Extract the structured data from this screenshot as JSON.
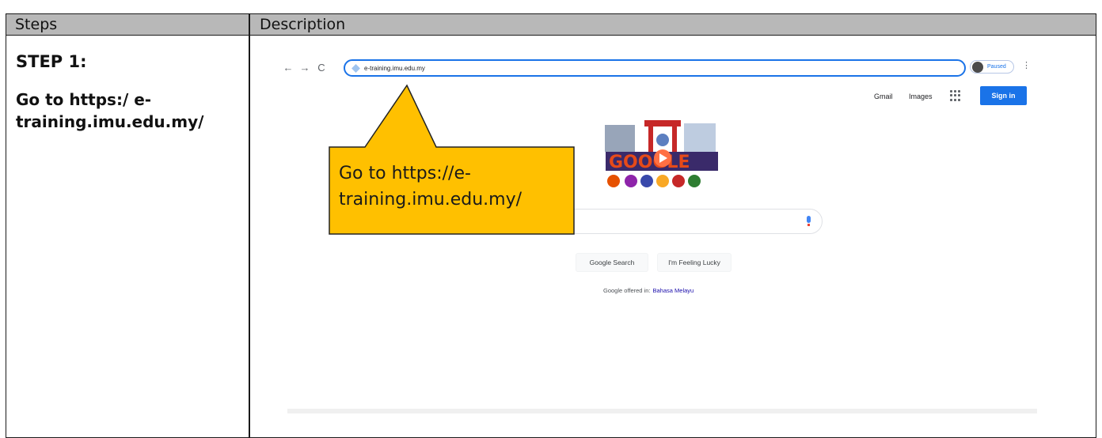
{
  "table": {
    "headers": [
      "Steps",
      "Description"
    ]
  },
  "step": {
    "title": "STEP 1:",
    "text": "Go to https:/ e-\ntraining.imu.edu.my/"
  },
  "browser": {
    "url": "e-training.imu.edu.my",
    "profile_label": "Paused",
    "nav_icons": [
      "back-arrow-icon",
      "forward-arrow-icon",
      "reload-icon"
    ]
  },
  "google": {
    "gmail": "Gmail",
    "images": "Images",
    "sign_in": "Sign in",
    "doodle_text": "GOOGLE",
    "search_button": "Google Search",
    "lucky_button": "I'm Feeling Lucky",
    "offered_in": "Google offered in:",
    "language": "Bahasa Melayu"
  },
  "callout": {
    "text": "Go to https://e-\ntraining.imu.edu.my/",
    "fill": "#ffc000"
  },
  "colors": {
    "header_bg": "#b8b8b8",
    "accent": "#1a73e8"
  }
}
